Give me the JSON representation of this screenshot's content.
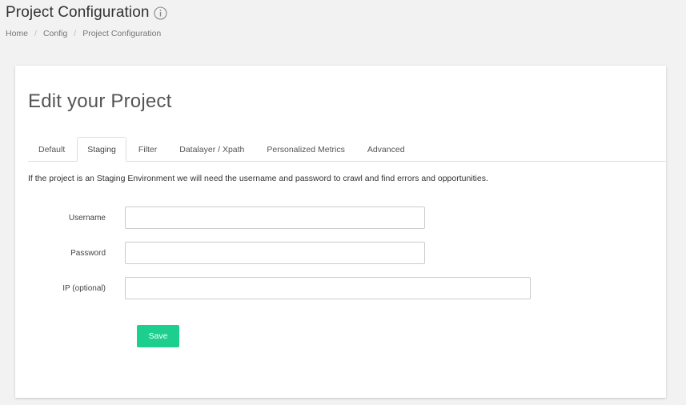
{
  "header": {
    "title": "Project Configuration",
    "info_icon": "info-icon"
  },
  "breadcrumb": {
    "items": [
      "Home",
      "Config",
      "Project Configuration"
    ],
    "separator": "/"
  },
  "card": {
    "title": "Edit your Project",
    "tabs": [
      {
        "label": "Default",
        "active": false
      },
      {
        "label": "Staging",
        "active": true
      },
      {
        "label": "Filter",
        "active": false
      },
      {
        "label": "Datalayer / Xpath",
        "active": false
      },
      {
        "label": "Personalized Metrics",
        "active": false
      },
      {
        "label": "Advanced",
        "active": false
      }
    ],
    "description": "If the project is an Staging Environment we will need the username and password to crawl and find errors and opportunities.",
    "form": {
      "username": {
        "label": "Username",
        "value": "",
        "placeholder": ""
      },
      "password": {
        "label": "Password",
        "value": "",
        "placeholder": ""
      },
      "ip": {
        "label": "IP (optional)",
        "value": "",
        "placeholder": ""
      }
    },
    "save_label": "Save"
  },
  "colors": {
    "accent": "#1dcf8f",
    "background": "#f2f2f2",
    "card": "#ffffff"
  }
}
